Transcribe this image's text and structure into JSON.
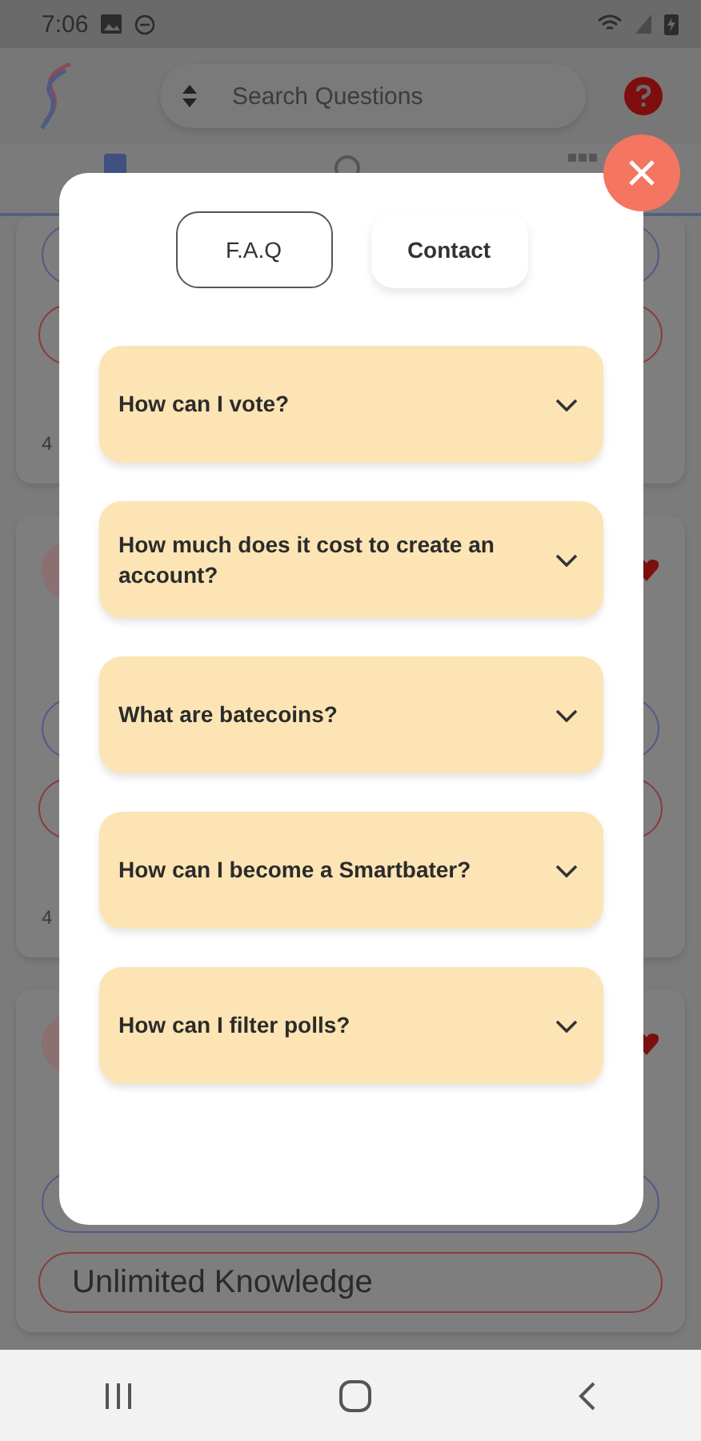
{
  "status_bar": {
    "time": "7:06"
  },
  "header": {
    "search": {
      "placeholder": "Search Questions"
    }
  },
  "background_cards": [
    {
      "kind": "cut",
      "count": "4"
    },
    {
      "kind": "full",
      "count": "4"
    },
    {
      "kind": "full",
      "answer": "Unlimited Knowledge"
    }
  ],
  "modal": {
    "tabs": [
      {
        "label": "F.A.Q",
        "selected": true
      },
      {
        "label": "Contact",
        "selected": false
      }
    ],
    "faq": [
      {
        "question": "How can I vote?",
        "expanded": false
      },
      {
        "question": "How much does it cost to create an account?",
        "expanded": false
      },
      {
        "question": "What are batecoins?",
        "expanded": false
      },
      {
        "question": "How can I become a Smartbater?",
        "expanded": false
      },
      {
        "question": "How can I filter polls?",
        "expanded": false
      }
    ]
  }
}
